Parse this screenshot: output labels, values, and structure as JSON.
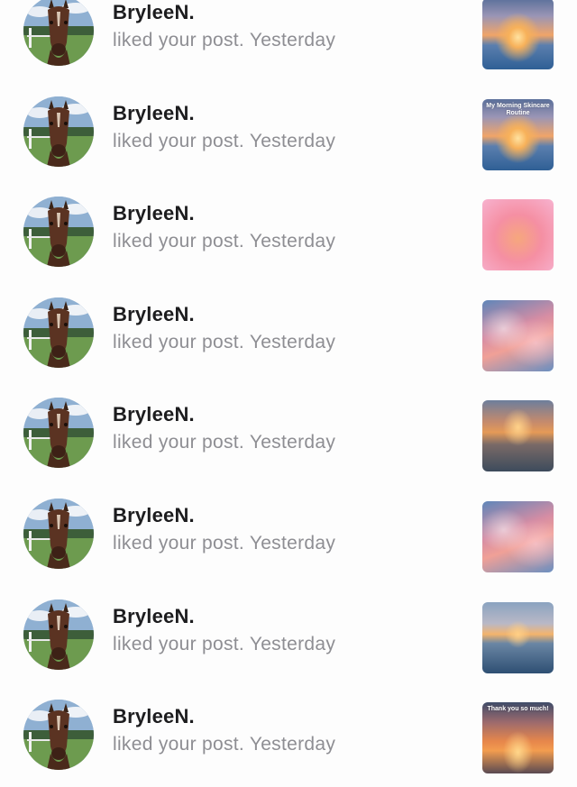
{
  "notifications": [
    {
      "username": "BryleeN.",
      "action": "liked your post.",
      "time": "Yesterday",
      "thumb_style": "sunset",
      "thumb_caption": ""
    },
    {
      "username": "BryleeN.",
      "action": "liked your post.",
      "time": "Yesterday",
      "thumb_style": "sunset",
      "thumb_caption": "My Morning Skincare Routine"
    },
    {
      "username": "BryleeN.",
      "action": "liked your post.",
      "time": "Yesterday",
      "thumb_style": "pink",
      "thumb_caption": ""
    },
    {
      "username": "BryleeN.",
      "action": "liked your post.",
      "time": "Yesterday",
      "thumb_style": "clouds",
      "thumb_caption": ""
    },
    {
      "username": "BryleeN.",
      "action": "liked your post.",
      "time": "Yesterday",
      "thumb_style": "dusk",
      "thumb_caption": ""
    },
    {
      "username": "BryleeN.",
      "action": "liked your post.",
      "time": "Yesterday",
      "thumb_style": "clouds",
      "thumb_caption": ""
    },
    {
      "username": "BryleeN.",
      "action": "liked your post.",
      "time": "Yesterday",
      "thumb_style": "sea",
      "thumb_caption": ""
    },
    {
      "username": "BryleeN.",
      "action": "liked your post.",
      "time": "Yesterday",
      "thumb_style": "orange",
      "thumb_caption": "Thank you so much!"
    }
  ],
  "colors": {
    "background": "#fdfdfd",
    "username": "#1c1c1e",
    "secondary_text": "#8e8e93"
  },
  "icons": {
    "avatar": "horse-avatar"
  }
}
